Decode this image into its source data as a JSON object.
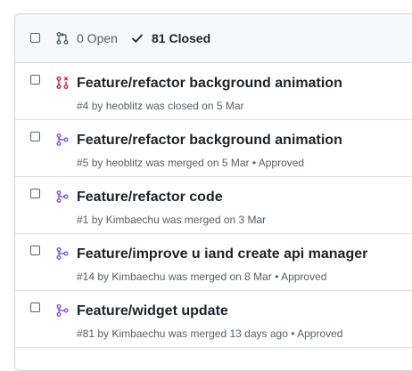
{
  "filters": {
    "open_label": "0 Open",
    "closed_label": "81 Closed"
  },
  "pull_requests": [
    {
      "title": "Feature/refactor background animation",
      "state": "closed",
      "number": "#4",
      "by": "by",
      "author": "heoblitz",
      "action": "was closed on 5 Mar",
      "review": ""
    },
    {
      "title": "Feature/refactor background animation",
      "state": "merged",
      "number": "#5",
      "by": "by",
      "author": "heoblitz",
      "action": "was merged on 5 Mar",
      "review": "• Approved"
    },
    {
      "title": "Feature/refactor code",
      "state": "merged",
      "number": "#1",
      "by": "by",
      "author": "Kimbaechu",
      "action": "was merged on 3 Mar",
      "review": ""
    },
    {
      "title": "Feature/improve u iand create api manager",
      "state": "merged",
      "number": "#14",
      "by": "by",
      "author": "Kimbaechu",
      "action": "was merged on 8 Mar",
      "review": "• Approved"
    },
    {
      "title": "Feature/widget update",
      "state": "merged",
      "number": "#81",
      "by": "by",
      "author": "Kimbaechu",
      "action": "was merged 13 days ago",
      "review": "• Approved"
    }
  ],
  "colors": {
    "closed_icon": "#cf222e",
    "merged_icon": "#8250df",
    "muted_text": "#57606a"
  },
  "icons": {
    "open": "git-pull-request-icon",
    "closed_filter": "check-icon",
    "closed_pr": "git-pull-request-closed-icon",
    "merged_pr": "git-merge-icon"
  }
}
